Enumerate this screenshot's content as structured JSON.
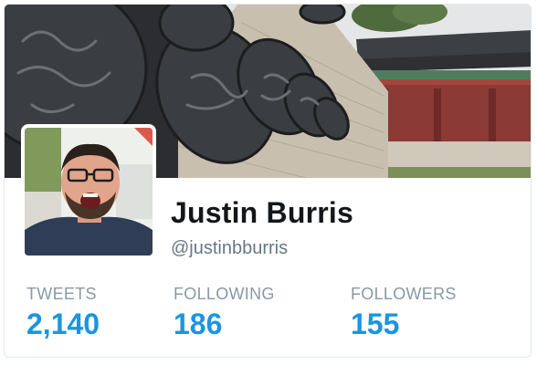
{
  "profile": {
    "name": "Justin Burris",
    "handle": "@justinbburris"
  },
  "stats": [
    {
      "label": "TWEETS",
      "value": "2,140"
    },
    {
      "label": "FOLLOWING",
      "value": "186"
    },
    {
      "label": "FOLLOWERS",
      "value": "155"
    }
  ],
  "colors": {
    "stat_value": "#1b95e0",
    "stat_label": "#8899a6",
    "name": "#14171a",
    "handle": "#657786",
    "card_border": "#e1e8ed"
  }
}
